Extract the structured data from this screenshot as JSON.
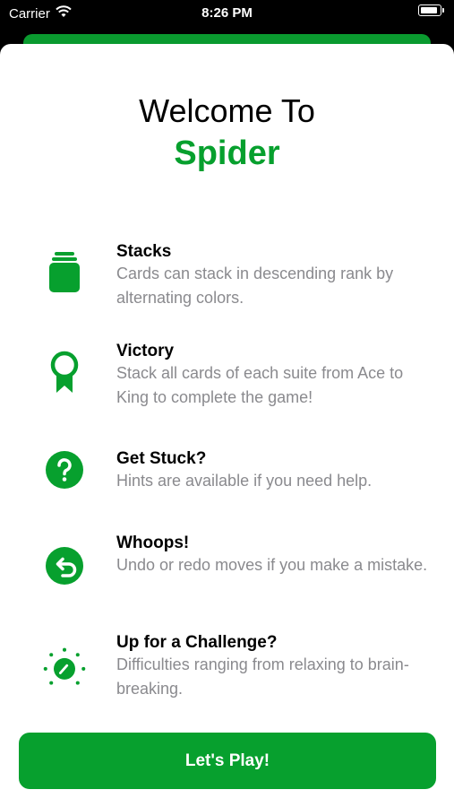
{
  "status_bar": {
    "carrier": "Carrier",
    "time": "8:26 PM"
  },
  "title": {
    "line1": "Welcome To",
    "line2": "Spider"
  },
  "features": [
    {
      "icon": "stack-icon",
      "title": "Stacks",
      "description": "Cards can stack in descending rank by alternating colors."
    },
    {
      "icon": "rosette-icon",
      "title": "Victory",
      "description": "Stack all cards of each suite from Ace to King to complete the game!"
    },
    {
      "icon": "question-circle-icon",
      "title": "Get Stuck?",
      "description": "Hints are available if you need help."
    },
    {
      "icon": "undo-circle-icon",
      "title": "Whoops!",
      "description": "Undo or redo moves if you make a mistake."
    },
    {
      "icon": "dial-icon",
      "title": "Up for a Challenge?",
      "description": "Difficulties ranging from relaxing to brain-breaking."
    }
  ],
  "button": {
    "label": "Let's Play!"
  },
  "colors": {
    "accent": "#07a02e",
    "description_text": "#8a8a8e"
  }
}
